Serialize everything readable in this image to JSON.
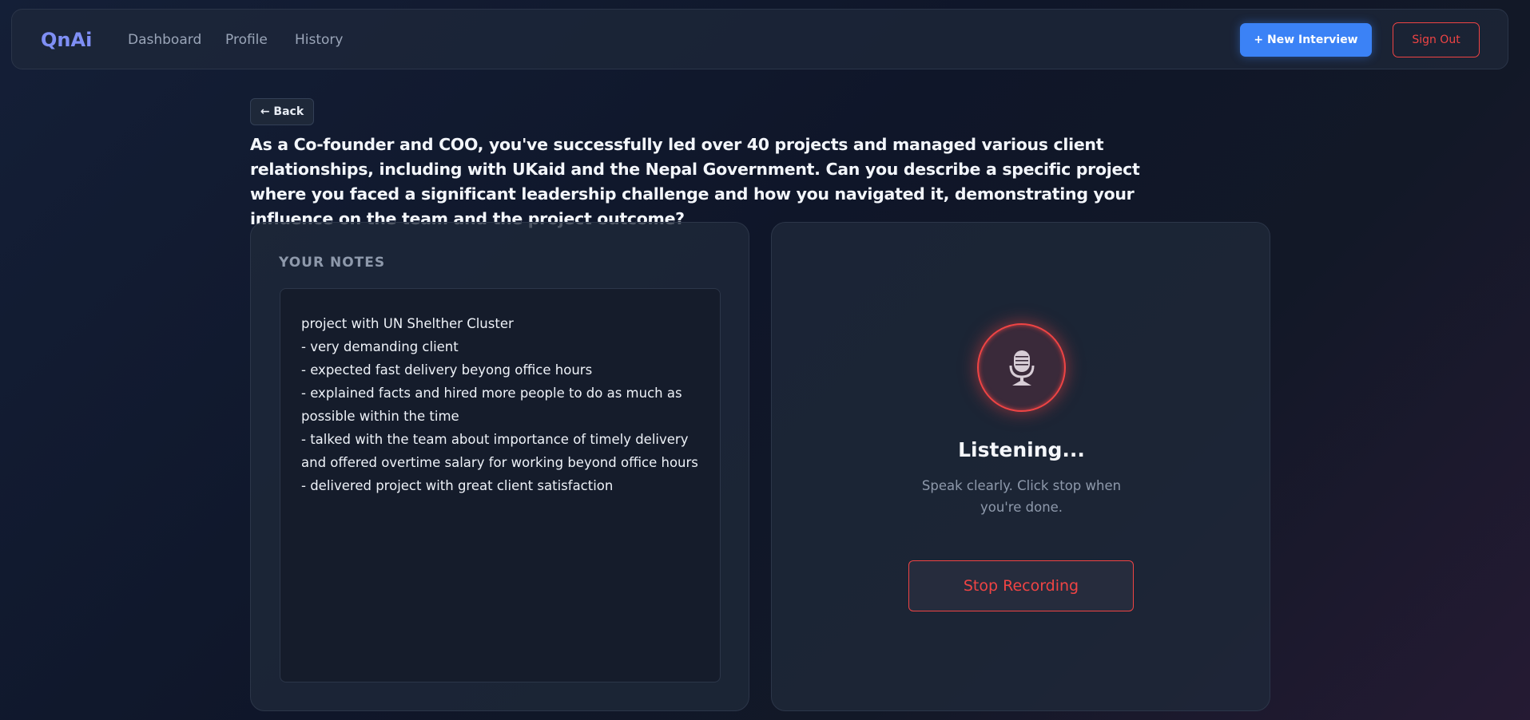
{
  "navbar": {
    "logo": "QnAi",
    "links": [
      "Dashboard",
      "Profile",
      "History"
    ],
    "new_interview_label": "+ New Interview",
    "sign_out_label": "Sign Out"
  },
  "back_label": "← Back",
  "question": "As a Co-founder and COO, you've successfully led over 40 projects and managed various client relationships, including with UKaid and the Nepal Government. Can you describe a specific project where you faced a significant leadership challenge and how you navigated it, demonstrating your influence on the team and the project outcome?",
  "notes": {
    "title": "YOUR NOTES",
    "content": "project with UN Shelther Cluster\n- very demanding client\n- expected fast delivery beyong office hours\n- explained facts and hired more people to do as much as possible within the time\n- talked with the team about importance of timely delivery and offered overtime salary for working beyond office hours\n- delivered project with great client satisfaction"
  },
  "recording": {
    "icon": "microphone-icon",
    "status_title": "Listening...",
    "status_subtitle": "Speak clearly. Click stop when you're done.",
    "stop_label": "Stop Recording"
  },
  "colors": {
    "accent": "#3b82f6",
    "danger": "#ef4444",
    "logo": "#7f8ff5"
  }
}
